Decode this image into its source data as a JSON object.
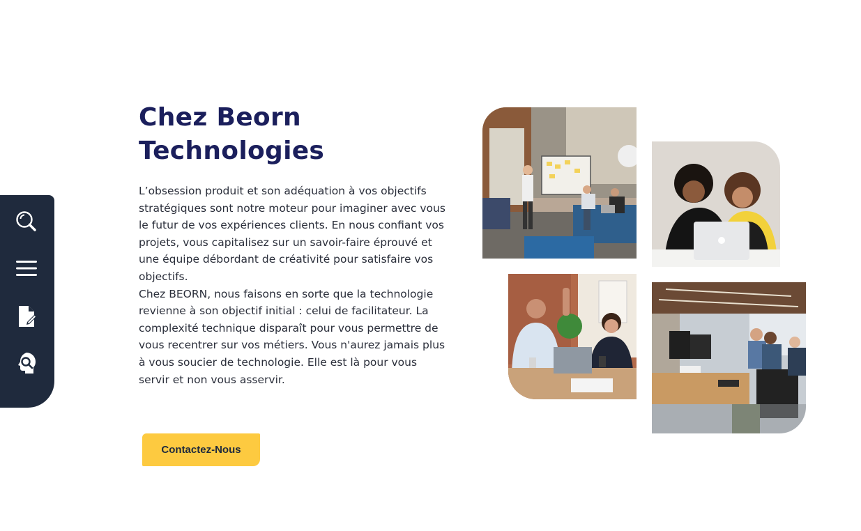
{
  "sidebar": {
    "items": [
      {
        "icon": "search-icon"
      },
      {
        "icon": "menu-icon"
      },
      {
        "icon": "document-edit-icon"
      },
      {
        "icon": "support-icon"
      }
    ],
    "bg_color": "#1f2a3d"
  },
  "hero": {
    "title_line1": "Chez Beorn",
    "title_line2": "Technologies",
    "paragraph1": "L’obsession produit et son adéquation à vos objectifs stratégiques sont notre moteur pour imaginer avec vous le futur de vos expériences clients. En nous confiant vos projets, vous capitalisez sur un savoir-faire éprouvé et une équipe débordant de créativité pour satisfaire vos objectifs.",
    "paragraph2": "Chez BEORN, nous faisons en sorte que la technologie revienne à son objectif initial : celui de facilitateur. La complexité technique disparaît pour vous permettre de vous recentrer sur vos métiers. Vous n'aurez jamais plus à vous soucier de technologie. Elle est là pour vous servir et non vous asservir.",
    "cta_label": "Contactez-Nous"
  },
  "colors": {
    "title": "#1b1f5c",
    "accent": "#fdca40",
    "text": "#2a2e3a"
  }
}
